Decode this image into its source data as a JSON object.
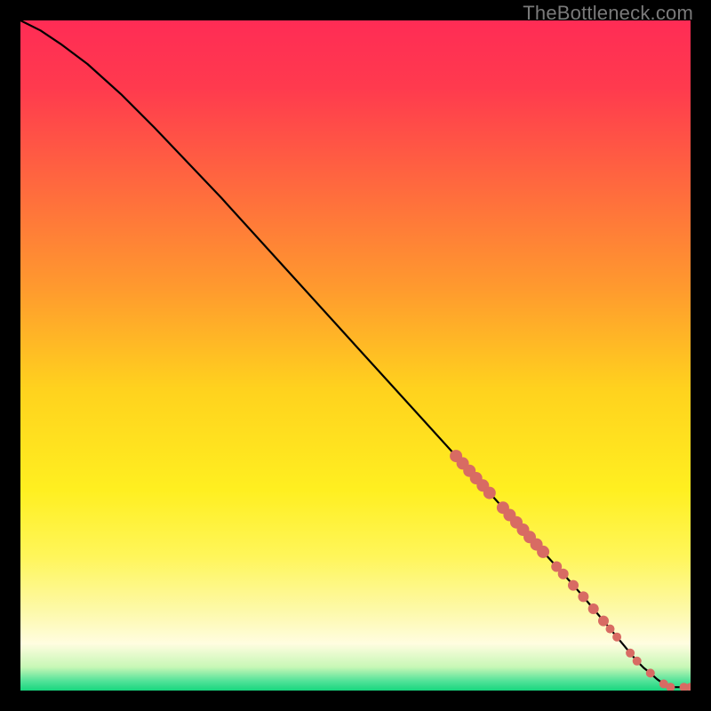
{
  "watermark": "TheBottleneck.com",
  "colors": {
    "marker": "#d86b63",
    "curve": "#000000",
    "gradient_top": "#ff2c55",
    "gradient_bottom": "#18d67e"
  },
  "chart_data": {
    "type": "line",
    "title": "",
    "xlabel": "",
    "ylabel": "",
    "xlim": [
      0,
      100
    ],
    "ylim": [
      0,
      100
    ],
    "grid": false,
    "legend": false,
    "series": [
      {
        "name": "curve",
        "x": [
          0,
          3,
          6,
          10,
          15,
          20,
          30,
          40,
          50,
          60,
          65,
          70,
          72,
          74,
          76,
          78,
          80,
          82,
          84,
          85,
          86,
          87,
          88,
          89,
          90,
          91,
          92,
          93,
          94,
          95,
          96,
          97,
          100
        ],
        "y": [
          100,
          98.5,
          96.5,
          93.5,
          89,
          84,
          73.5,
          62.5,
          51.5,
          40.5,
          35,
          29.5,
          27.3,
          25.1,
          22.9,
          20.7,
          18.5,
          16.3,
          14,
          12.8,
          11.6,
          10.4,
          9.2,
          8,
          6.8,
          5.6,
          4.4,
          3.4,
          2.6,
          1.7,
          1,
          0.5,
          0.5
        ]
      }
    ],
    "markers": [
      {
        "x": 65.0,
        "y": 35.0,
        "r": 7
      },
      {
        "x": 66.0,
        "y": 33.9,
        "r": 7
      },
      {
        "x": 67.0,
        "y": 32.8,
        "r": 7
      },
      {
        "x": 68.0,
        "y": 31.7,
        "r": 7
      },
      {
        "x": 69.0,
        "y": 30.6,
        "r": 7
      },
      {
        "x": 70.0,
        "y": 29.5,
        "r": 7
      },
      {
        "x": 72.0,
        "y": 27.3,
        "r": 7
      },
      {
        "x": 73.0,
        "y": 26.2,
        "r": 7
      },
      {
        "x": 74.0,
        "y": 25.1,
        "r": 7
      },
      {
        "x": 75.0,
        "y": 24.0,
        "r": 7
      },
      {
        "x": 76.0,
        "y": 22.9,
        "r": 7
      },
      {
        "x": 77.0,
        "y": 21.8,
        "r": 7
      },
      {
        "x": 78.0,
        "y": 20.7,
        "r": 7
      },
      {
        "x": 80.0,
        "y": 18.5,
        "r": 6
      },
      {
        "x": 81.0,
        "y": 17.4,
        "r": 6
      },
      {
        "x": 82.5,
        "y": 15.7,
        "r": 6
      },
      {
        "x": 84.0,
        "y": 14.0,
        "r": 6
      },
      {
        "x": 85.5,
        "y": 12.2,
        "r": 6
      },
      {
        "x": 87.0,
        "y": 10.4,
        "r": 6
      },
      {
        "x": 88.0,
        "y": 9.2,
        "r": 5
      },
      {
        "x": 89.0,
        "y": 8.0,
        "r": 5
      },
      {
        "x": 91.0,
        "y": 5.6,
        "r": 5
      },
      {
        "x": 92.0,
        "y": 4.4,
        "r": 5
      },
      {
        "x": 94.0,
        "y": 2.6,
        "r": 5
      },
      {
        "x": 96.0,
        "y": 1.0,
        "r": 5
      },
      {
        "x": 97.0,
        "y": 0.5,
        "r": 5
      },
      {
        "x": 99.0,
        "y": 0.5,
        "r": 5
      },
      {
        "x": 100.0,
        "y": 0.5,
        "r": 5
      }
    ]
  }
}
